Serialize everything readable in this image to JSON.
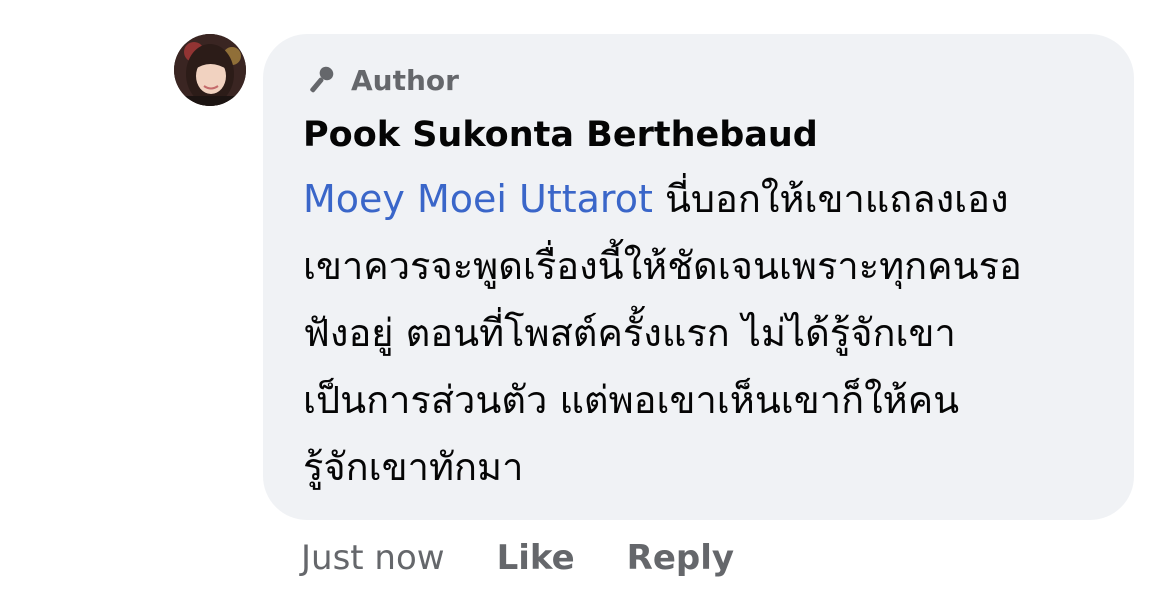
{
  "comment": {
    "badge": {
      "icon": "microphone-icon",
      "label": "Author"
    },
    "author_name": "Pook Sukonta Berthebaud",
    "mention": "Moey Moei Uttarot",
    "text_lines": [
      " นี่บอกให้เขาแถลงเอง",
      "เขาควรจะพูดเรื่องนี้ให้ชัดเจนเพราะทุกคนรอ",
      "ฟังอยู่ ตอนที่โพสต์ครั้งแรก ไม่ได้รู้จักเขา",
      "เป็นการส่วนตัว แต่พอเขาเห็นเขาก็ให้คน",
      "รู้จักเขาทักมา"
    ],
    "timestamp": "Just now",
    "actions": {
      "like": "Like",
      "reply": "Reply"
    },
    "colors": {
      "bubble_bg": "#f0f2f5",
      "mention": "#3a66c9",
      "secondary_text": "#65676b",
      "primary_text": "#050505"
    }
  }
}
